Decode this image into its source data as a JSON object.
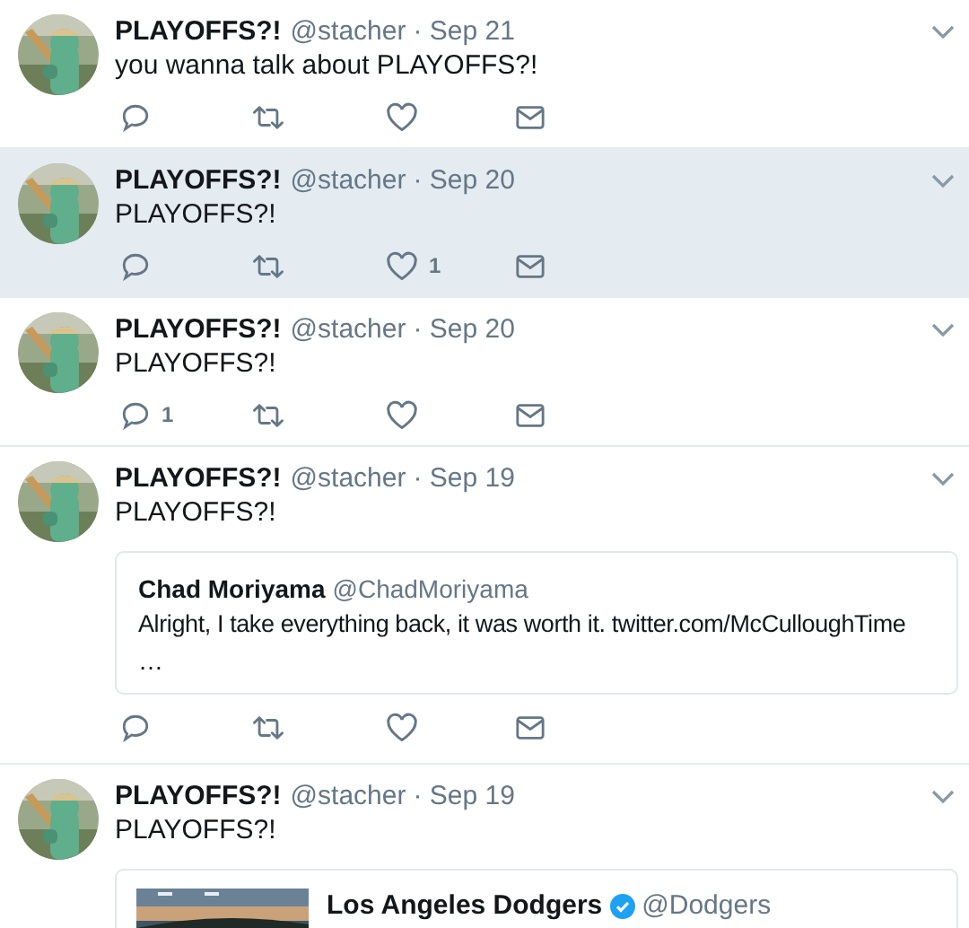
{
  "tweets": [
    {
      "name": "PLAYOFFS?!",
      "handle": "@stacher",
      "date": "· Sep 21",
      "text": "you wanna talk about PLAYOFFS?!",
      "highlighted": false,
      "actions": true
    },
    {
      "name": "PLAYOFFS?!",
      "handle": "@stacher",
      "date": "· Sep 20",
      "text": "PLAYOFFS?!",
      "highlighted": true,
      "actions": true,
      "likes": "1"
    },
    {
      "name": "PLAYOFFS?!",
      "handle": "@stacher",
      "date": "· Sep 20",
      "text": "PLAYOFFS?!",
      "highlighted": false,
      "actions": true,
      "replies": "1"
    },
    {
      "name": "PLAYOFFS?!",
      "handle": "@stacher",
      "date": "· Sep 19",
      "text": "PLAYOFFS?!",
      "highlighted": false,
      "actions": true,
      "quote": {
        "kind": "text",
        "name": "Chad Moriyama",
        "handle": "@ChadMoriyama",
        "text": "Alright, I take everything back, it was worth it. twitter.com/McCulloughTime",
        "more": "…"
      }
    },
    {
      "name": "PLAYOFFS?!",
      "handle": "@stacher",
      "date": "· Sep 19",
      "text": "PLAYOFFS?!",
      "highlighted": false,
      "quote": {
        "kind": "media",
        "name": "Los Angeles Dodgers",
        "verified": true,
        "handle": "@Dodgers"
      }
    }
  ]
}
